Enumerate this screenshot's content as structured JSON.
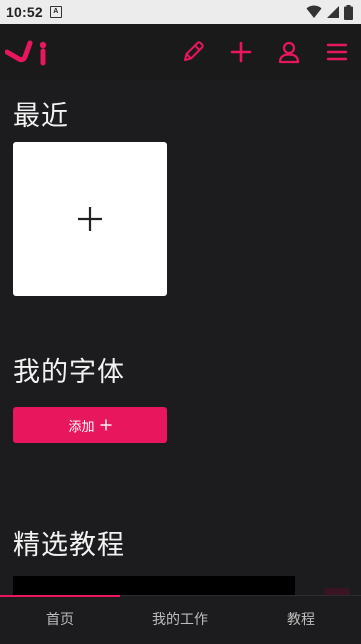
{
  "status_bar": {
    "time": "10:52",
    "notification_letter": "A"
  },
  "top_bar": {
    "logo_icon": "ji-logo",
    "icons": [
      "pencil-icon",
      "plus-icon",
      "user-icon",
      "menu-icon"
    ]
  },
  "sections": {
    "recent_title": "最近",
    "my_fonts_title": "我的字体",
    "add_button_label": "添加",
    "tutorials_title": "精选教程"
  },
  "bottom_nav": {
    "items": [
      "首页",
      "我的工作",
      "教程"
    ],
    "active_index": 0
  },
  "colors": {
    "accent": "#e8175d",
    "background": "#1c1c1e",
    "topbar": "#1a1a1a",
    "status_bar": "#ececec"
  }
}
